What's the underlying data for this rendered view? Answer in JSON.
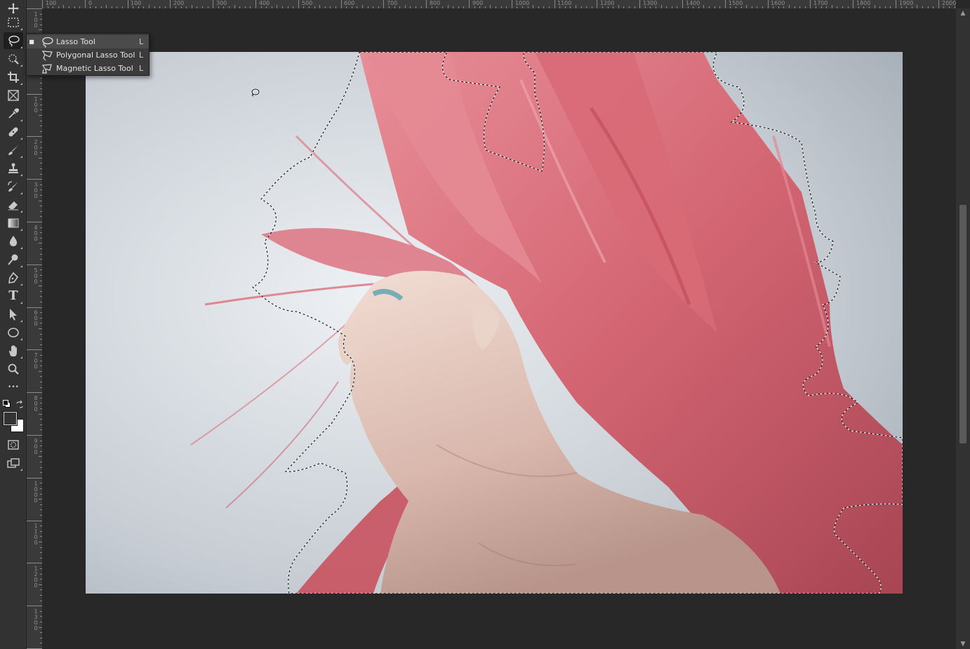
{
  "toolbar": {
    "tools": [
      {
        "name": "move-tool",
        "icon": "move-icon"
      },
      {
        "name": "rectangular-marquee-tool",
        "icon": "marquee-icon"
      },
      {
        "name": "lasso-tool",
        "icon": "lasso-icon",
        "active": true
      },
      {
        "name": "quick-selection-tool",
        "icon": "quick-selection-icon"
      },
      {
        "name": "crop-tool",
        "icon": "crop-icon"
      },
      {
        "name": "frame-tool",
        "icon": "frame-icon"
      },
      {
        "name": "eyedropper-tool",
        "icon": "eyedropper-icon"
      },
      {
        "name": "healing-brush-tool",
        "icon": "bandage-icon"
      },
      {
        "name": "brush-tool",
        "icon": "brush-icon"
      },
      {
        "name": "clone-stamp-tool",
        "icon": "stamp-icon"
      },
      {
        "name": "history-brush-tool",
        "icon": "history-brush-icon"
      },
      {
        "name": "eraser-tool",
        "icon": "eraser-icon"
      },
      {
        "name": "gradient-tool",
        "icon": "gradient-icon"
      },
      {
        "name": "blur-tool",
        "icon": "drop-icon"
      },
      {
        "name": "dodge-tool",
        "icon": "dodge-icon"
      },
      {
        "name": "pen-tool",
        "icon": "pen-icon"
      },
      {
        "name": "type-tool",
        "icon": "type-icon",
        "glyph": "T"
      },
      {
        "name": "path-selection-tool",
        "icon": "arrow-icon"
      },
      {
        "name": "ellipse-tool",
        "icon": "ellipse-icon"
      },
      {
        "name": "hand-tool",
        "icon": "hand-icon"
      },
      {
        "name": "zoom-tool",
        "icon": "zoom-icon"
      },
      {
        "name": "edit-toolbar",
        "icon": "more-icon",
        "glyph": "•••"
      }
    ],
    "foreground_color": "#333333",
    "background_color": "#ffffff"
  },
  "ruler": {
    "top_labels": [
      "100",
      "0",
      "100",
      "200",
      "300",
      "400",
      "500",
      "600",
      "700",
      "800",
      "900",
      "1000",
      "1100",
      "1200",
      "1300",
      "1400",
      "1500",
      "1600",
      "1700",
      "1800",
      "1900",
      "2000"
    ],
    "left_labels": [
      "100",
      "0",
      "100",
      "200",
      "300",
      "400",
      "500",
      "600",
      "700",
      "800",
      "900",
      "1000",
      "1100",
      "1200",
      "1300"
    ]
  },
  "flyout": {
    "items": [
      {
        "label": "Lasso Tool",
        "key": "L",
        "selected": true,
        "icon": "lasso-icon"
      },
      {
        "label": "Polygonal Lasso Tool",
        "key": "L",
        "selected": false,
        "icon": "polygonal-lasso-icon"
      },
      {
        "label": "Magnetic Lasso Tool",
        "key": "L",
        "selected": false,
        "icon": "magnetic-lasso-icon"
      }
    ]
  },
  "colors": {
    "panel": "#323232",
    "canvas_bg": "#282828",
    "hair": "#d2606b",
    "backdrop": "#c9ced4"
  }
}
